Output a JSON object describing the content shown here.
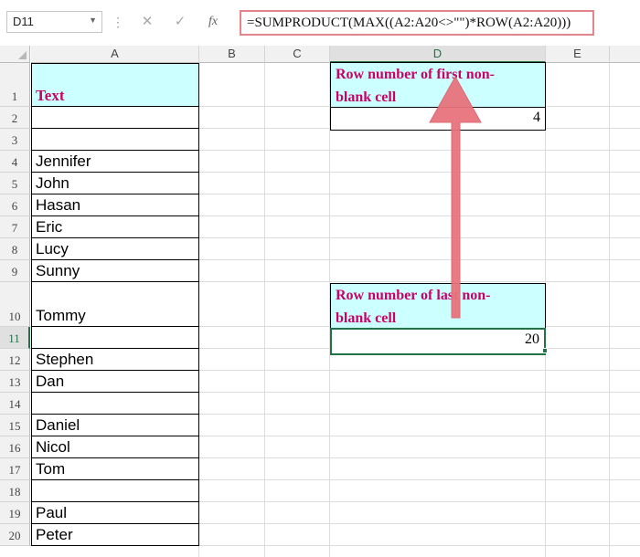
{
  "formula_bar": {
    "name_box": "D11",
    "cancel_symbol": "✕",
    "enter_symbol": "✓",
    "fx_label": "fx",
    "formula": "=SUMPRODUCT(MAX((A2:A20<>\"\")*ROW(A2:A20)))"
  },
  "columns": [
    "A",
    "B",
    "C",
    "D",
    "E"
  ],
  "selected_column": "D",
  "selected_row": "11",
  "rows": [
    {
      "num": "1",
      "a": "Text"
    },
    {
      "num": "2",
      "a": ""
    },
    {
      "num": "3",
      "a": ""
    },
    {
      "num": "4",
      "a": "Jennifer"
    },
    {
      "num": "5",
      "a": "John"
    },
    {
      "num": "6",
      "a": "Hasan"
    },
    {
      "num": "7",
      "a": "Eric"
    },
    {
      "num": "8",
      "a": "Lucy"
    },
    {
      "num": "9",
      "a": "Sunny"
    },
    {
      "num": "10",
      "a": "Tommy"
    },
    {
      "num": "11",
      "a": ""
    },
    {
      "num": "12",
      "a": "Stephen"
    },
    {
      "num": "13",
      "a": "Dan"
    },
    {
      "num": "14",
      "a": ""
    },
    {
      "num": "15",
      "a": "Daniel"
    },
    {
      "num": "16",
      "a": "Nicol"
    },
    {
      "num": "17",
      "a": "Tom"
    },
    {
      "num": "18",
      "a": ""
    },
    {
      "num": "19",
      "a": "Paul"
    },
    {
      "num": "20",
      "a": "Peter"
    }
  ],
  "result_first": {
    "label": "Row number of first non-blank cell",
    "line1": "Row number of first non-",
    "line2": "blank cell",
    "value": "4"
  },
  "result_last": {
    "label": "Row number of last non-blank cell",
    "line1": "Row number of last non-",
    "line2": "blank cell",
    "value": "20"
  },
  "colors": {
    "header_fill": "#ccffff",
    "header_text": "#cc0066",
    "arrow": "#e8737d",
    "selection": "#217346"
  }
}
